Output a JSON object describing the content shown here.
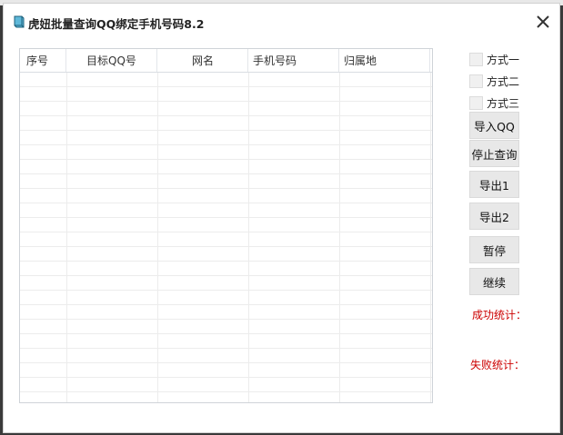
{
  "window": {
    "title": "虎妞批量查询QQ绑定手机号码8.2"
  },
  "table": {
    "columns": [
      "序号",
      "目标QQ号",
      "网名",
      "手机号码",
      "归属地"
    ],
    "rows": []
  },
  "options": [
    {
      "label": "方式一",
      "checked": false
    },
    {
      "label": "方式二",
      "checked": false
    },
    {
      "label": "方式三",
      "checked": false
    }
  ],
  "buttons": {
    "import_qq": "导入QQ",
    "stop_query": "停止查询",
    "export1": "导出1",
    "export2": "导出2",
    "pause": "暂停",
    "resume": "继续"
  },
  "stats": {
    "success_label": "成功统计：",
    "fail_label": "失败统计："
  },
  "colors": {
    "stat_text": "#cc0000",
    "button_bg": "#e8e8e8"
  }
}
